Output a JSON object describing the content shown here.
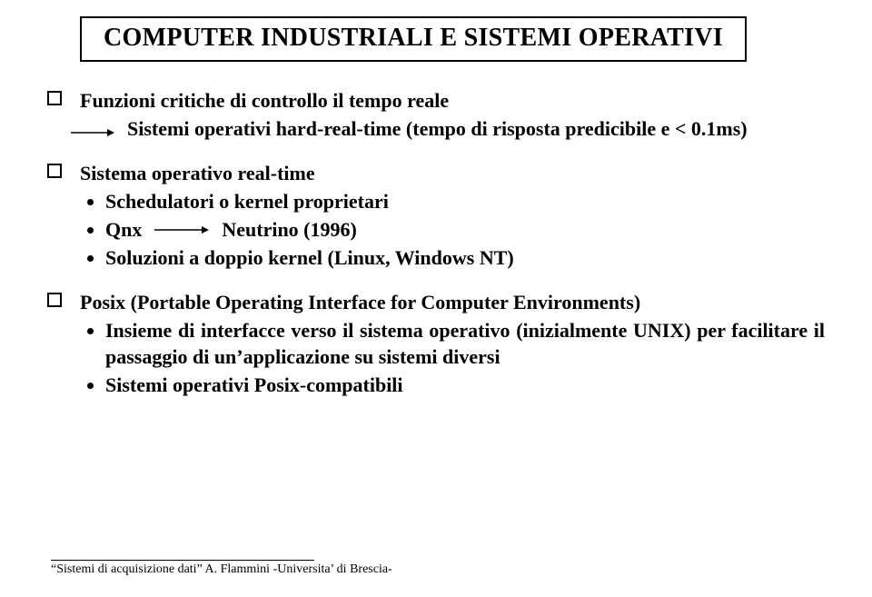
{
  "title": "COMPUTER INDUSTRIALI E SISTEMI OPERATIVI",
  "items": [
    {
      "head": "Funzioni critiche di controllo il tempo reale",
      "implies": "Sistemi operativi hard-real-time (tempo di risposta predicibile e < 0.1ms)"
    },
    {
      "head": "Sistema operativo real-time",
      "bullets": [
        "Schedulatori o kernel proprietari",
        "Soluzioni a doppio kernel (Linux, Windows NT)"
      ],
      "qnx": {
        "label": "Qnx",
        "target": "Neutrino (1996)"
      }
    },
    {
      "head": "Posix (Portable Operating Interface for Computer Environments)",
      "bullets": [
        "Insieme di interfacce verso il sistema operativo (inizialmente UNIX) per facilitare il passaggio di un’applicazione su sistemi diversi",
        "Sistemi operativi Posix-compatibili"
      ]
    }
  ],
  "footer": "“Sistemi di acquisizione dati”   A. Flammini  -Universita’ di Brescia-"
}
